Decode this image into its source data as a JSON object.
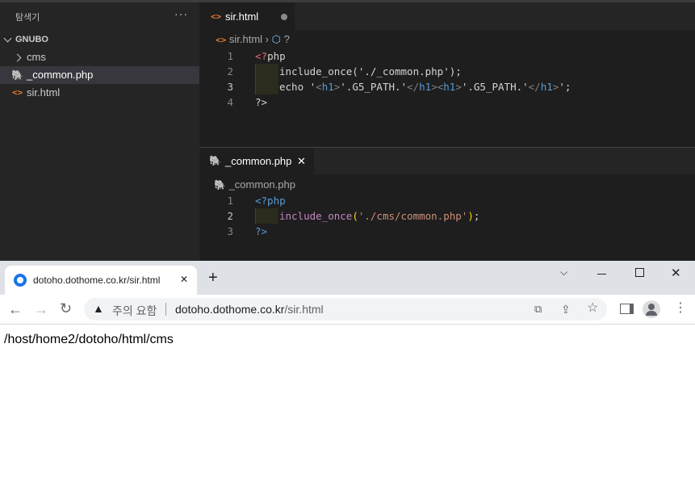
{
  "vscode": {
    "explorer": {
      "title": "탐색기",
      "more": "···",
      "folder": "GNUBO",
      "items": [
        {
          "label": "cms",
          "type": "folder"
        },
        {
          "label": "_common.php",
          "type": "php",
          "selected": true
        },
        {
          "label": "sir.html",
          "type": "html"
        }
      ]
    },
    "editor1": {
      "tab_label": "sir.html",
      "breadcrumb": {
        "file": "sir.html",
        "symbol": "?"
      },
      "lines": [
        {
          "num": "1",
          "tokens": [
            {
              "t": "<?",
              "c": "#e06c75"
            },
            {
              "t": "php",
              "c": "#d4d4d4"
            }
          ]
        },
        {
          "num": "2",
          "tokens": [
            {
              "t": "include_once('./_common.php');",
              "c": "#d4d4d4"
            }
          ]
        },
        {
          "num": "3",
          "tokens": [
            {
              "t": "echo '",
              "c": "#d4d4d4"
            },
            {
              "t": "<",
              "c": "#808080"
            },
            {
              "t": "h1",
              "c": "#569cd6"
            },
            {
              "t": ">",
              "c": "#808080"
            },
            {
              "t": "'.G5_PATH.'",
              "c": "#d4d4d4"
            },
            {
              "t": "</",
              "c": "#808080"
            },
            {
              "t": "h1",
              "c": "#569cd6"
            },
            {
              "t": "><",
              "c": "#808080"
            },
            {
              "t": "h1",
              "c": "#569cd6"
            },
            {
              "t": ">",
              "c": "#808080"
            },
            {
              "t": "'.G5_PATH.'",
              "c": "#d4d4d4"
            },
            {
              "t": "</",
              "c": "#808080"
            },
            {
              "t": "h1",
              "c": "#569cd6"
            },
            {
              "t": ">",
              "c": "#808080"
            },
            {
              "t": "';",
              "c": "#d4d4d4"
            }
          ]
        },
        {
          "num": "4",
          "tokens": [
            {
              "t": "?>",
              "c": "#d4d4d4"
            }
          ]
        }
      ]
    },
    "editor2": {
      "tab_label": "_common.php",
      "close": "✕",
      "breadcrumb": {
        "file": "_common.php"
      },
      "lines": [
        {
          "num": "1",
          "tokens": [
            {
              "t": "<?php",
              "c": "#569cd6"
            }
          ]
        },
        {
          "num": "2",
          "tokens": [
            {
              "t": "include_once",
              "c": "#c586c0"
            },
            {
              "t": "(",
              "c": "#ffd700"
            },
            {
              "t": "'./cms/common.php'",
              "c": "#ce9178"
            },
            {
              "t": ")",
              "c": "#ffd700"
            },
            {
              "t": ";",
              "c": "#d4d4d4"
            }
          ]
        },
        {
          "num": "3",
          "tokens": [
            {
              "t": "?>",
              "c": "#569cd6"
            }
          ]
        }
      ]
    }
  },
  "browser": {
    "tab_title": "dotoho.dothome.co.kr/sir.html",
    "tab_close": "✕",
    "new_tab": "+",
    "security_label": "주의 요함",
    "url_host": "dotoho.dothome.co.kr",
    "url_path": "/sir.html",
    "page_text": "/host/home2/dotoho/html/cms",
    "accent": "#1a73e8"
  }
}
